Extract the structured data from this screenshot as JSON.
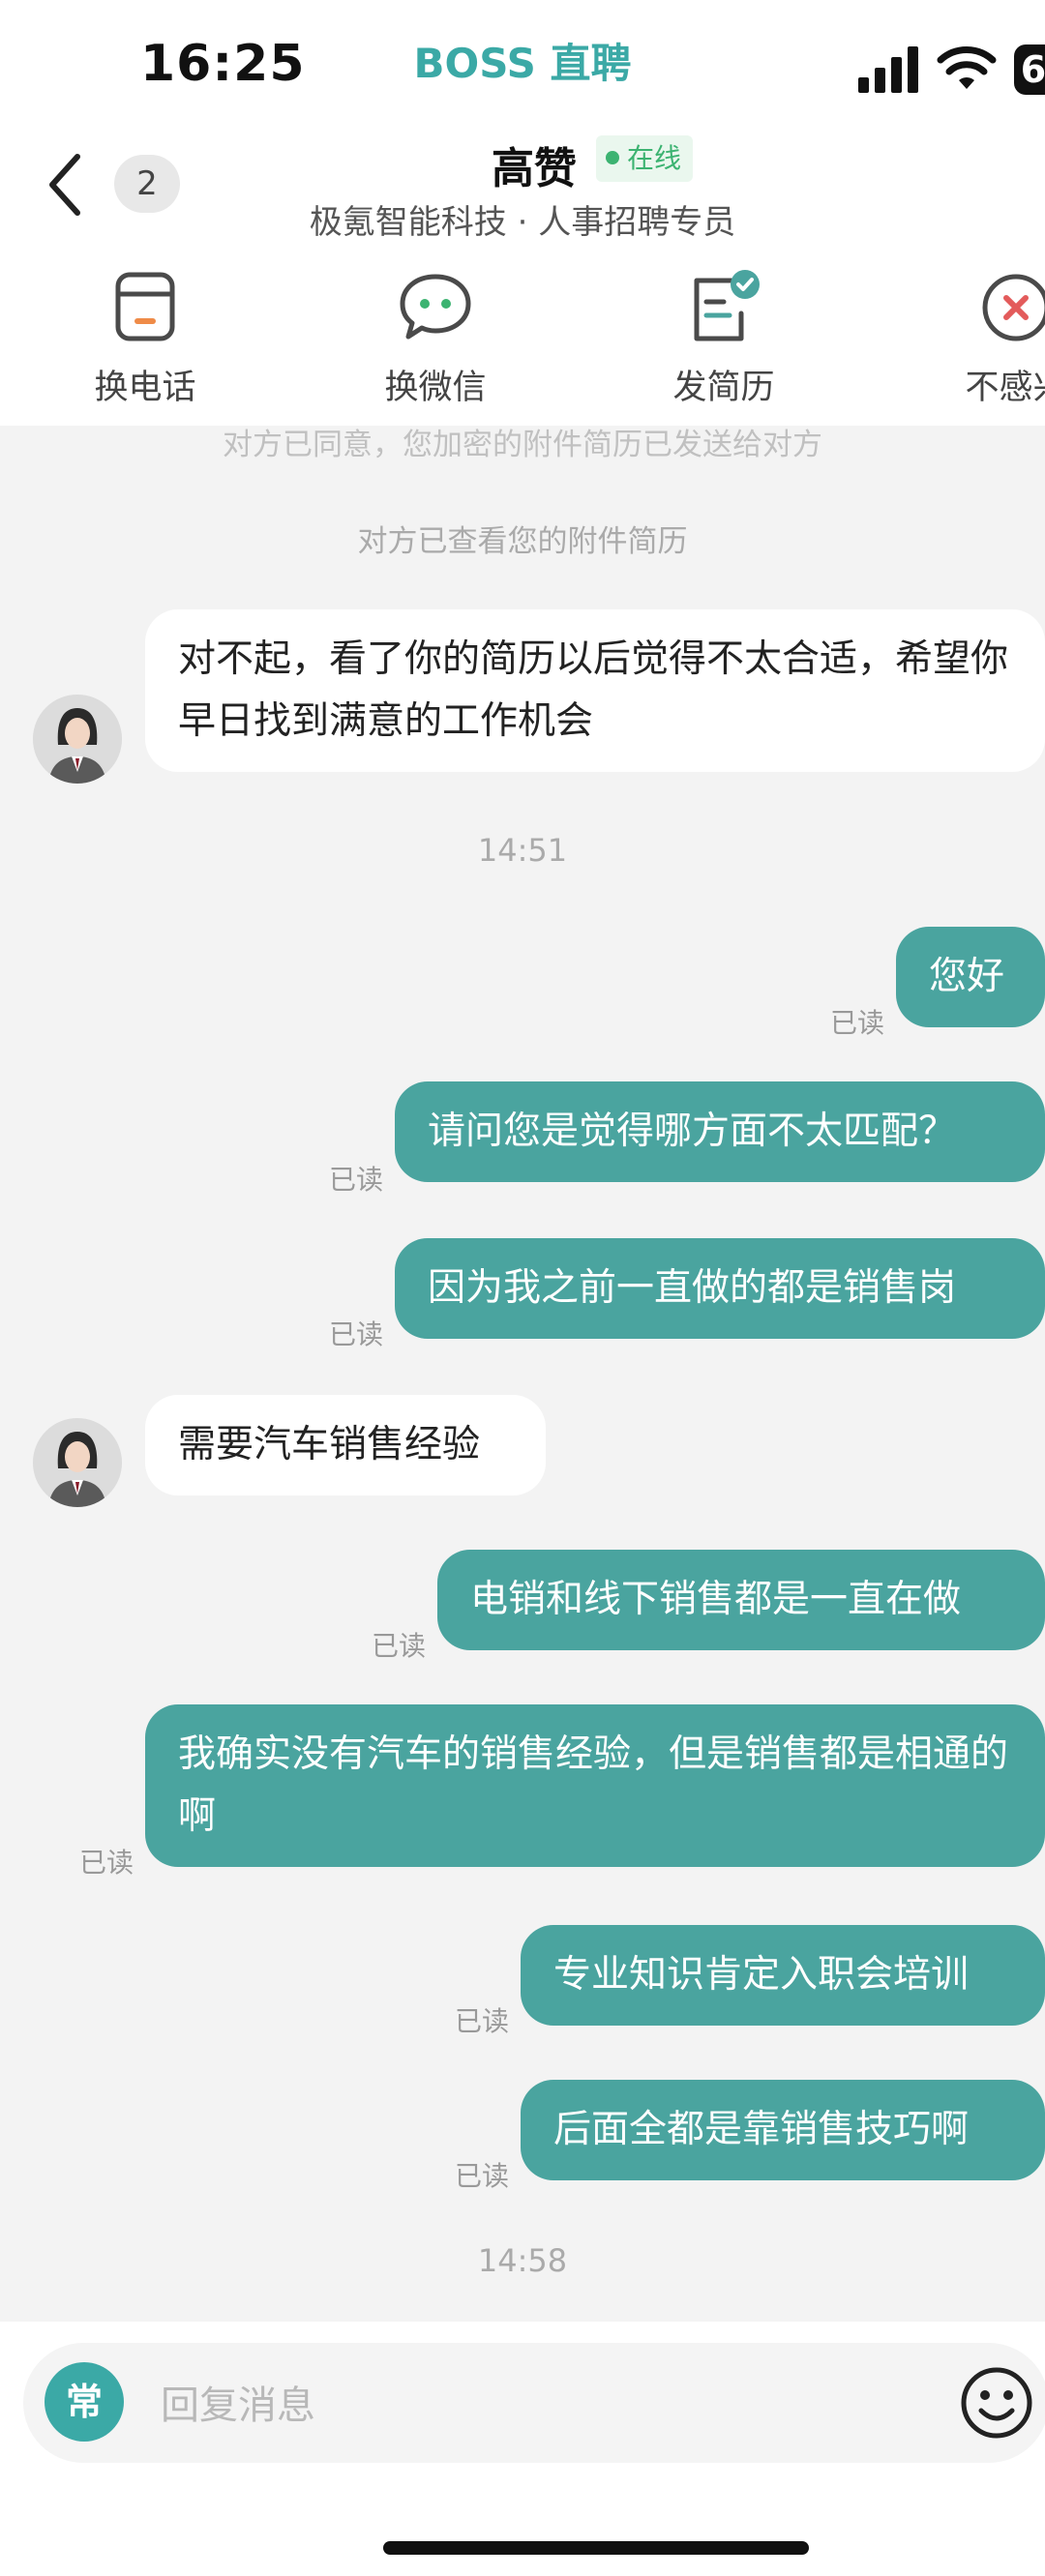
{
  "status_bar": {
    "time": "16:25",
    "app_logo": "BOSS 直聘",
    "battery_text": "6"
  },
  "header": {
    "unread_count": "2",
    "contact_name": "高赞",
    "online_status": "在线",
    "subtitle": "极氪智能科技 · 人事招聘专员",
    "actions": [
      {
        "label": "换电话",
        "icon": "phone-icon"
      },
      {
        "label": "换微信",
        "icon": "chat-bubble-icon"
      },
      {
        "label": "发简历",
        "icon": "resume-icon"
      },
      {
        "label": "不感兴",
        "icon": "not-interested-icon"
      }
    ]
  },
  "messages": {
    "sys_partial": "对方已同意，您加密的附件简历已发送给对方",
    "sys_viewed": "对方已查看您的附件简历",
    "m1": "对不起，看了你的简历以后觉得不太合适，希望你早日找到满意的工作机会",
    "time1": "14:51",
    "m2": "您好",
    "m3": "请问您是觉得哪方面不太匹配？",
    "m4": "因为我之前一直做的都是销售岗",
    "m5": "需要汽车销售经验",
    "m6": "电销和线下销售都是一直在做",
    "m7": "我确实没有汽车的销售经验，但是销售都是相通的啊",
    "m8": "专业知识肯定入职会培训",
    "m9": "后面全都是靠销售技巧啊",
    "time2": "14:58",
    "read_label": "已读"
  },
  "input": {
    "common_phrases_label": "常",
    "placeholder": "回复消息"
  },
  "colors": {
    "accent": "#4aa49f",
    "logo": "#3ba9a6",
    "online": "#3cb371",
    "warn": "#e35b5b"
  }
}
